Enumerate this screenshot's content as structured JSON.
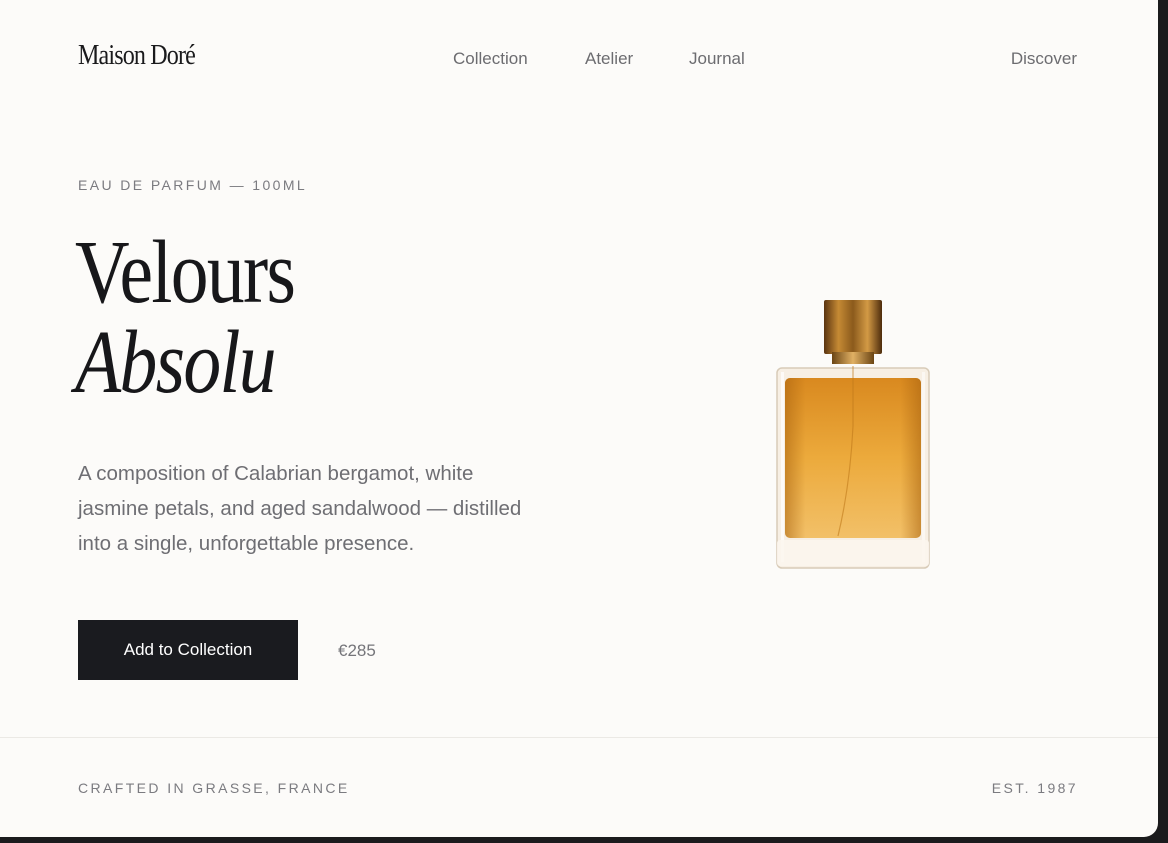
{
  "brand": {
    "logo_text": "Maison Doré"
  },
  "nav": {
    "items": [
      {
        "label": "Collection"
      },
      {
        "label": "Atelier"
      },
      {
        "label": "Journal"
      }
    ],
    "discover_label": "Discover"
  },
  "hero": {
    "eyebrow": "EAU DE PARFUM — 100ML",
    "title_line1": "Velours",
    "title_line2": "Absolu",
    "description": "A composition of Calabrian bergamot, white jasmine petals, and aged sandalwood — distilled into a single, unforgettable presence.",
    "cta_label": "Add to Collection",
    "price": "€285"
  },
  "footer": {
    "left_text": "CRAFTED IN GRASSE, FRANCE",
    "right_text": "EST. 1987"
  },
  "colors": {
    "background": "#fcfbf9",
    "text_primary": "#17171a",
    "text_secondary": "#6e6e73",
    "button_bg": "#1a1b1f",
    "perfume_amber": "#e8a53a",
    "cap_gold": "#a86f1e"
  },
  "icons": {
    "product_image": "perfume-bottle-image"
  }
}
